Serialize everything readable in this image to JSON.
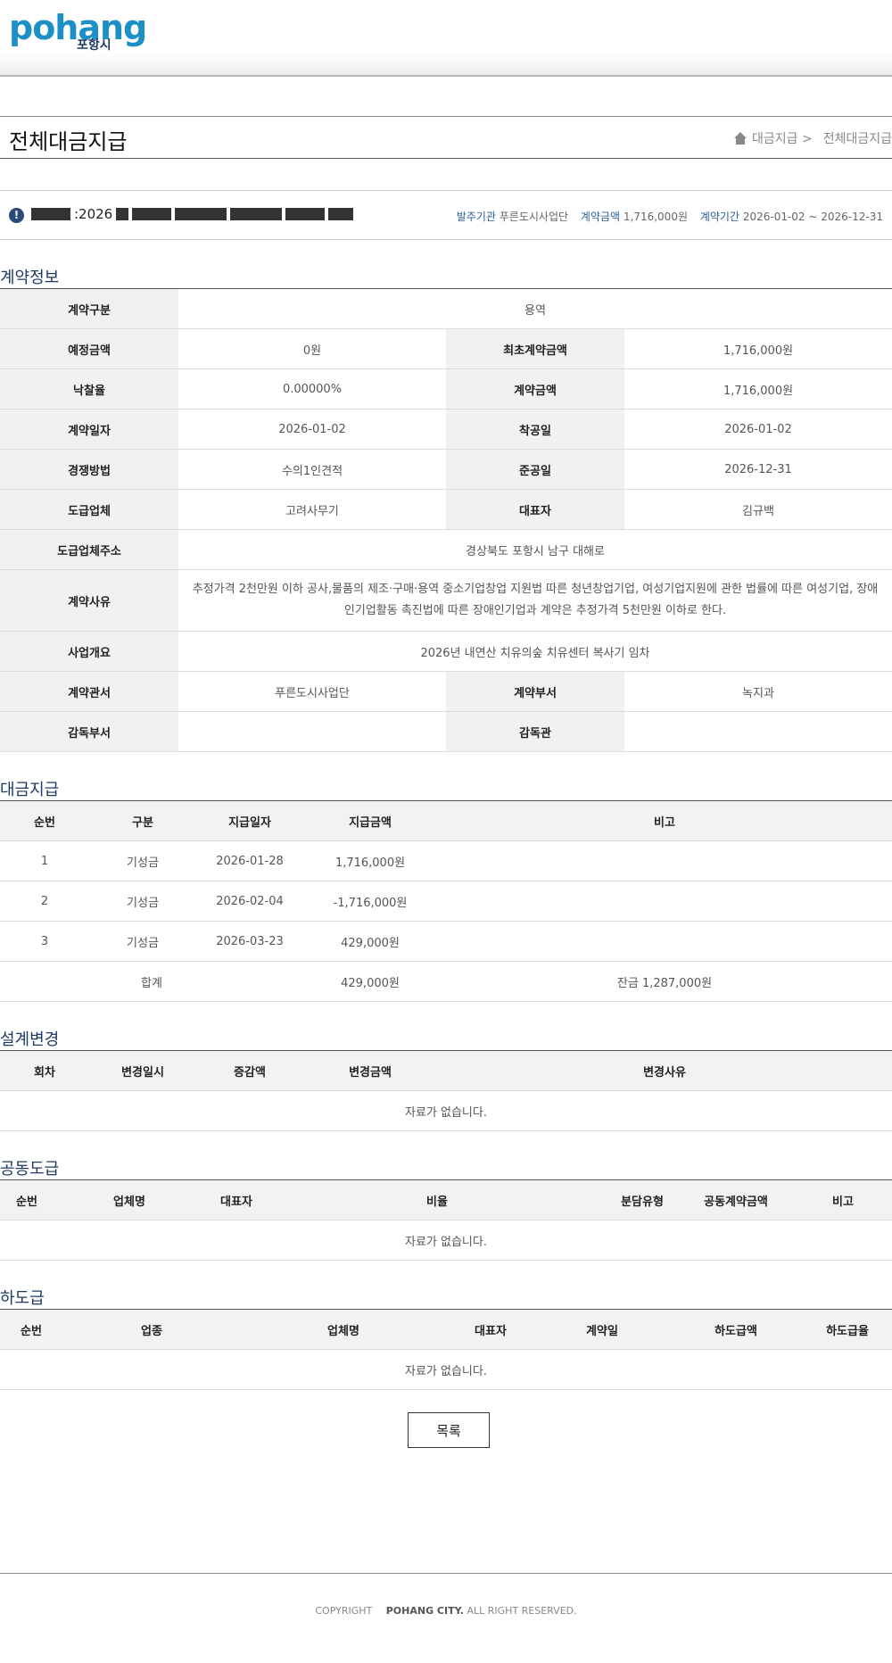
{
  "header": {
    "logo_word": "pohang",
    "logo_sub": "포항시"
  },
  "page": {
    "title": "전체대금지급",
    "breadcrumb": [
      "대금지급 >",
      "전체대금지급"
    ]
  },
  "info": {
    "masked_prefix": ":2026",
    "org_label": "발주기관",
    "org_value": "푸른도시사업단",
    "amount_label": "계약금액",
    "amount_value": "1,716,000원",
    "period_label": "계약기간",
    "period_value": "2026-01-02 ~ 2026-12-31"
  },
  "contract": {
    "section_title": "계약정보",
    "type_label": "계약구분",
    "type_value": "용역",
    "est_label": "예정금액",
    "est_value": "0원",
    "first_label": "최초계약금액",
    "first_value": "1,716,000원",
    "rate_label": "낙찰율",
    "rate_value": "0.00000%",
    "amount_label": "계약금액",
    "amount_value": "1,716,000원",
    "date_label": "계약일자",
    "date_value": "2026-01-02",
    "start_label": "착공일",
    "start_value": "2026-01-02",
    "method_label": "경쟁방법",
    "method_value": "수의1인견적",
    "end_label": "준공일",
    "end_value": "2026-12-31",
    "company_label": "도급업체",
    "company_value": "고려사무기",
    "ceo_label": "대표자",
    "ceo_value": "김규백",
    "addr_label": "도급업체주소",
    "addr_value": "경상북도 포항시 남구 대해로",
    "reason_label": "계약사유",
    "reason_value": "추정가격 2천만원 이하 공사,물품의 제조·구매·용역 중소기업창업 지원법 따른 청년창업기업, 여성기업지원에 관한 법률에 따른 여성기업, 장애인기업활동 촉진법에 따른 장애인기업과 계약은 추정가격 5천만원 이하로 한다.",
    "summary_label": "사업개요",
    "summary_value": "2026년 내연산 치유의숲 치유센터 복사기 임차",
    "office_label": "계약관서",
    "office_value": "푸른도시사업단",
    "dept_label": "계약부서",
    "dept_value": "녹지과",
    "sup_dept_label": "감독부서",
    "sup_dept_value": "",
    "supervisor_label": "감독관",
    "supervisor_value": ""
  },
  "payment": {
    "section_title": "대금지급",
    "headers": [
      "순번",
      "구분",
      "지급일자",
      "지급금액",
      "비고"
    ],
    "rows": [
      [
        "1",
        "기성금",
        "2026-01-28",
        "1,716,000원",
        ""
      ],
      [
        "2",
        "기성금",
        "2026-02-04",
        "-1,716,000원",
        ""
      ],
      [
        "3",
        "기성금",
        "2026-03-23",
        "429,000원",
        ""
      ]
    ],
    "total_label": "합계",
    "total_value": "429,000원",
    "balance": "잔금 1,287,000원"
  },
  "design": {
    "section_title": "설계변경",
    "headers": [
      "회차",
      "변경일시",
      "증감액",
      "변경금액",
      "변경사유"
    ],
    "empty": "자료가 없습니다."
  },
  "joint": {
    "section_title": "공동도급",
    "headers": [
      "순번",
      "업체명",
      "대표자",
      "비율",
      "분담유형",
      "공동계약금액",
      "비고"
    ],
    "empty": "자료가 없습니다."
  },
  "subcontract": {
    "section_title": "하도급",
    "headers": [
      "순번",
      "업종",
      "업체명",
      "대표자",
      "계약일",
      "하도급액",
      "하도급율"
    ],
    "empty": "자료가 없습니다."
  },
  "buttons": {
    "list": "목록"
  },
  "footer": {
    "copyright": "COPYRIGHT",
    "owner": "POHANG CITY.",
    "rights": "ALL RIGHT RESERVED."
  }
}
